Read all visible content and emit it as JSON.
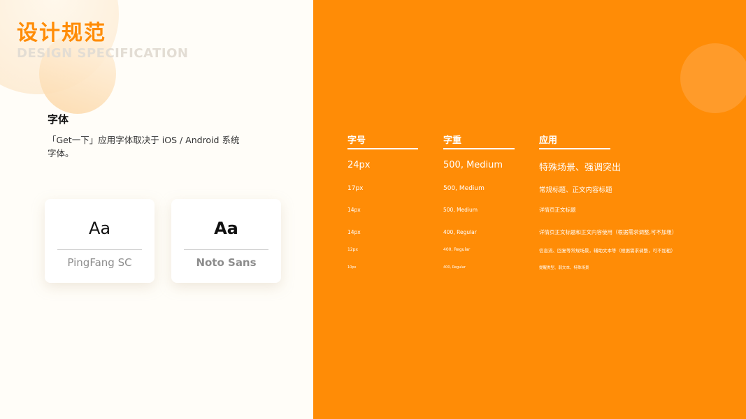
{
  "header": {
    "title_cn": "设计规范",
    "title_en": "DESIGN SPECIFICATION"
  },
  "intro": {
    "heading": "字体",
    "description": "「Get一下」应用字体取决于 iOS / Android 系统字体。"
  },
  "fonts": [
    {
      "sample": "Aa",
      "name": "PingFang SC"
    },
    {
      "sample": "Aa",
      "name": "Noto Sans"
    }
  ],
  "table": {
    "headers": [
      "字号",
      "字重",
      "应用"
    ],
    "rows": [
      {
        "size": "24px",
        "weight": "500, Medium",
        "usage": "特殊场景、强调突出"
      },
      {
        "size": "17px",
        "weight": "500, Medium",
        "usage": "常规标题、正文内容标题"
      },
      {
        "size": "14px",
        "weight": "500, Medium",
        "usage": "详情页正文标题"
      },
      {
        "size": "14px",
        "weight": "400, Regular",
        "usage": "详情页正文标题和正文内容使用（根据需求调整,可不加粗）"
      },
      {
        "size": "12px",
        "weight": "400, Regular",
        "usage": "信息流、回复等常规场景，辅助文本等（根据需求调整，可不加粗）"
      },
      {
        "size": "10px",
        "weight": "400, Regular",
        "usage": "提醒类型、弱文本、特殊场景"
      }
    ]
  },
  "colors": {
    "accent": "#ff8c06",
    "background": "#fffdf8"
  }
}
